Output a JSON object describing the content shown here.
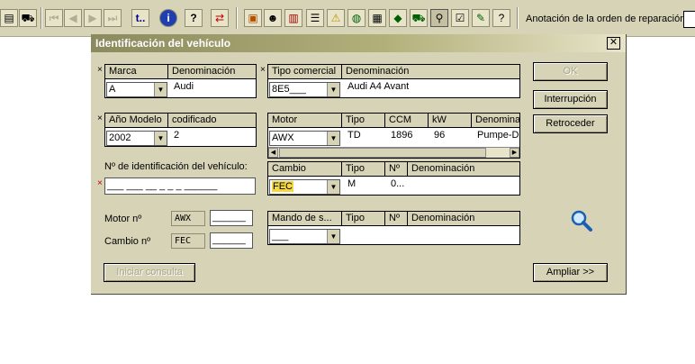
{
  "toolbar": {
    "annotation_label": "Anotación de la orden de reparación:",
    "text_buttons": {
      "t": "t..",
      "info": "i",
      "help": "?"
    }
  },
  "dialog": {
    "title": "Identificación del vehículo",
    "close_symbol": "✕",
    "marca": {
      "header": "Marca",
      "desc_header": "Denominación",
      "value": "A",
      "description": "Audi"
    },
    "tipo_comercial": {
      "header": "Tipo comercial",
      "desc_header": "Denominación",
      "value": "8E5___",
      "description": "Audi A4 Avant"
    },
    "anio_modelo": {
      "header": "Año Modelo",
      "desc_header": "codificado",
      "value": "2002",
      "code": "2"
    },
    "motor_table": {
      "headers": [
        "Motor",
        "Tipo",
        "CCM",
        "kW",
        "Denomina"
      ],
      "combo_value": "AWX",
      "row": {
        "tipo": "TD",
        "ccm": "1896",
        "kw": "96",
        "denominacion": "Pumpe-Du"
      }
    },
    "cambio_table": {
      "headers": [
        "Cambio",
        "Tipo",
        "Nº",
        "Denominación"
      ],
      "combo_value": "FEC",
      "row": {
        "tipo": "M",
        "numero": "0..."
      }
    },
    "mando_table": {
      "headers": [
        "Mando de s...",
        "Tipo",
        "Nº",
        "Denominación"
      ],
      "combo_value": "___"
    },
    "vin_label": "Nº de identificación del vehículo:",
    "vin_value": "___ ___ __ _ _ _ ______",
    "motor_no_label": "Motor nº",
    "motor_no_code": "AWX",
    "motor_no_value": "______",
    "cambio_no_label": "Cambio nº",
    "cambio_no_code": "FEC",
    "cambio_no_value": "______",
    "required_marker": "×",
    "buttons": {
      "ok": "OK",
      "interrupcion": "Interrupción",
      "retroceder": "Retroceder",
      "iniciar": "Iniciar consulta",
      "ampliar": "Ampliar >>"
    }
  },
  "colors": {
    "dialog_bg": "#d6d3b7",
    "title_start": "#8b8a5e",
    "title_end": "#e7e4c9",
    "required_red": "#c00000",
    "highlight": "#f5d742"
  }
}
